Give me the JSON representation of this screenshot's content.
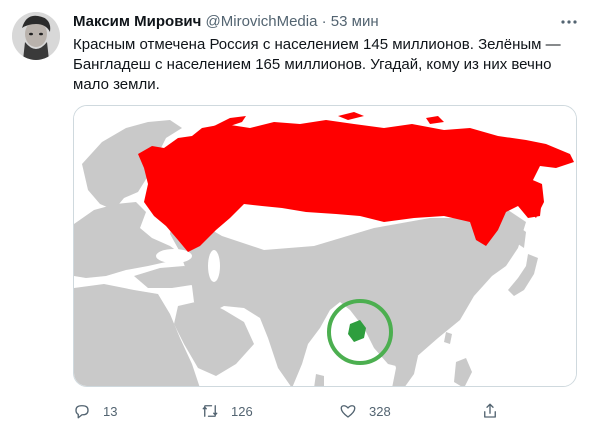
{
  "tweet": {
    "author_name": "Максим Мирович",
    "author_handle": "@MirovichMedia",
    "separator": "·",
    "time": "53 мин",
    "text_lines": [
      "Красным отмечена Россия с населением 145 миллионов. Зелёным —",
      "Бангладеш с населением 165 миллионов. Угадай, кому из них вечно",
      "мало земли."
    ]
  },
  "actions": {
    "reply_count": "13",
    "retweet_count": "126",
    "like_count": "328"
  },
  "icons": {
    "more": "more-dots-icon",
    "reply": "reply-icon",
    "retweet": "retweet-icon",
    "like": "heart-icon",
    "share": "share-icon"
  },
  "colors": {
    "russia": "#ff0000",
    "bangladesh": "#2e9e3e",
    "circle": "#4caf50",
    "land": "#c9c9c9",
    "sea": "#ffffff",
    "secondary_text": "#536471"
  }
}
